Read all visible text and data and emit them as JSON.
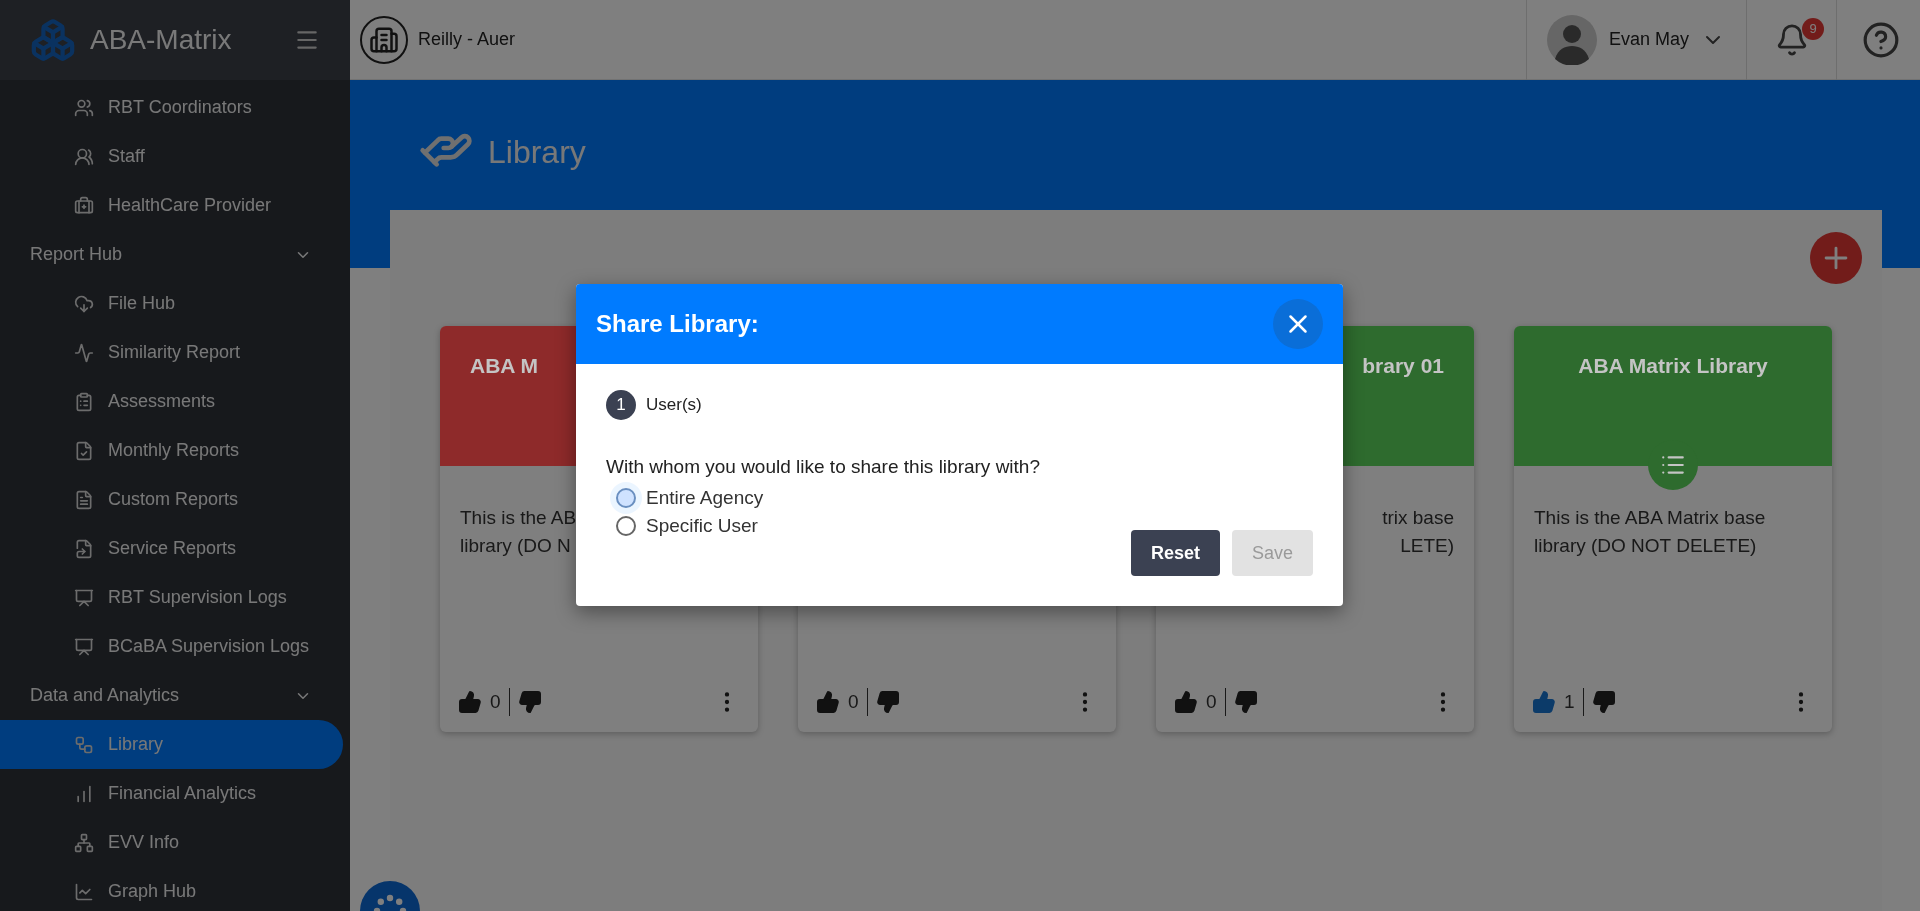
{
  "brand": {
    "name": "ABA-Matrix"
  },
  "sidebar": {
    "groups": [
      {
        "children": [
          {
            "label": "RBT Coordinators",
            "selected": false
          },
          {
            "label": "Staff",
            "selected": false
          },
          {
            "label": "HealthCare Provider",
            "selected": false
          }
        ]
      },
      {
        "label": "Report Hub",
        "expanded": true,
        "children": [
          {
            "label": "File Hub",
            "selected": false
          },
          {
            "label": "Similarity Report",
            "selected": false
          },
          {
            "label": "Assessments",
            "selected": false
          },
          {
            "label": "Monthly Reports",
            "selected": false
          },
          {
            "label": "Custom Reports",
            "selected": false
          },
          {
            "label": "Service Reports",
            "selected": false
          },
          {
            "label": "RBT Supervision Logs",
            "selected": false
          },
          {
            "label": "BCaBA Supervision Logs",
            "selected": false
          }
        ]
      },
      {
        "label": "Data and Analytics",
        "expanded": true,
        "children": [
          {
            "label": "Library",
            "selected": true
          },
          {
            "label": "Financial Analytics",
            "selected": false
          },
          {
            "label": "EVV Info",
            "selected": false
          },
          {
            "label": "Graph Hub",
            "selected": false
          }
        ]
      }
    ]
  },
  "top_bar": {
    "organization": "Reilly - Auer",
    "user": "Evan May",
    "notifications": "9"
  },
  "page": {
    "title": "Library"
  },
  "cards": [
    {
      "title": "ABA M",
      "lines": [
        "This is the AB",
        "library (DO N"
      ],
      "color": "#8e2a2a",
      "cut_on_left": false,
      "cut_on_right": true,
      "likes": "0",
      "liked": false
    },
    {
      "likes": "0",
      "liked": false
    },
    {
      "title": "brary 01",
      "lines": [
        "trix base",
        "LETE)"
      ],
      "color": "#2e6b2e",
      "cut_on_left": true,
      "likes": "0",
      "liked": false
    },
    {
      "title": "ABA Matrix Library",
      "lines": [
        "This is the ABA Matrix base",
        "library (DO NOT DELETE)"
      ],
      "color": "#2e6b2e",
      "cut_on_left": false,
      "cut_on_right": false,
      "list_icon": true,
      "likes": "1",
      "liked": true
    }
  ],
  "dialog": {
    "title": "Share Library:",
    "step": {
      "number": "1",
      "label": "User(s)"
    },
    "question": "With whom you would like to share this library with?",
    "options": [
      {
        "label": "Entire Agency",
        "selected": false,
        "focused": true
      },
      {
        "label": "Specific User",
        "selected": false,
        "focused": false
      }
    ],
    "buttons": [
      {
        "label": "Reset",
        "disabled": false
      },
      {
        "label": "Save",
        "disabled": true
      }
    ]
  }
}
